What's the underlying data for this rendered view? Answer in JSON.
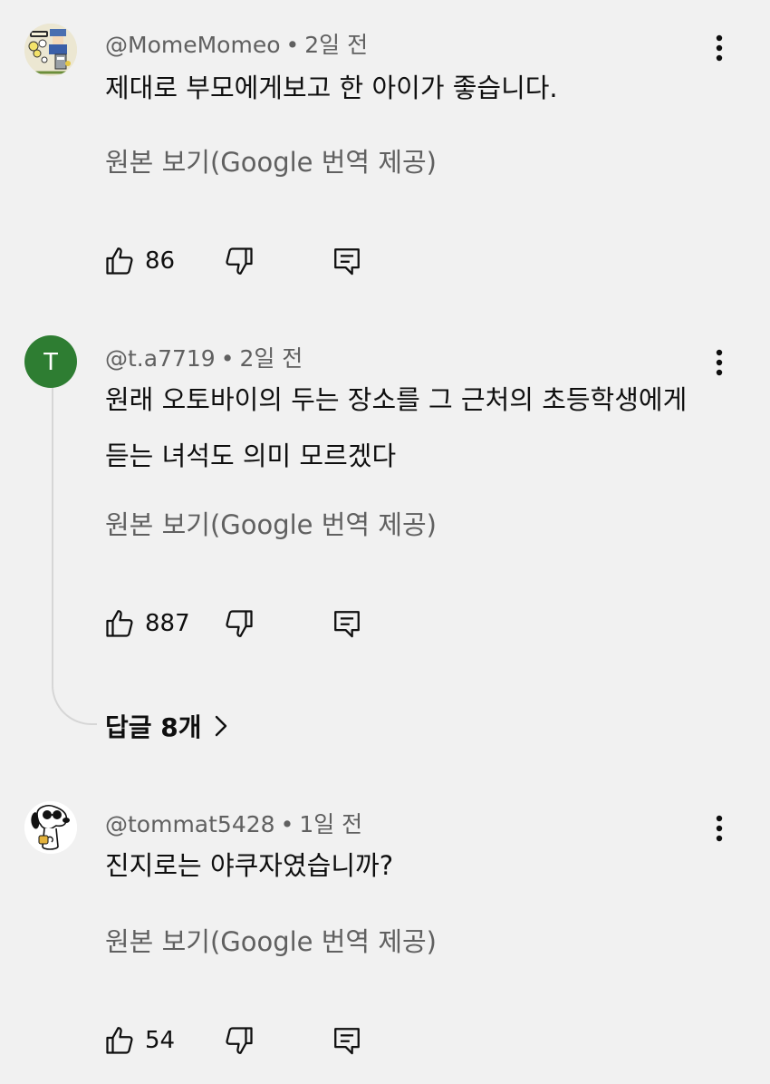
{
  "comments": [
    {
      "author": "@MomeMomeo",
      "age": "2일 전",
      "text_lines": [
        "제대로 부모에게보고 한 아이가 좋습니다."
      ],
      "translate_label": "원본 보기(Google 번역 제공)",
      "likes": "86",
      "avatar_icon": "cartoon-avatar"
    },
    {
      "author": "@t.a7719",
      "age": "2일 전",
      "text_lines": [
        "원래 오토바이의 두는 장소를 그 근처의 초등학생에게",
        "듣는 녀석도 의미 모르겠다"
      ],
      "translate_label": "원본 보기(Google 번역 제공)",
      "likes": "887",
      "avatar_letter": "T",
      "avatar_color": "#2e7d32"
    },
    {
      "author": "@tommat5428",
      "age": "1일 전",
      "text_lines": [
        "진지로는 야쿠자였습니까?"
      ],
      "translate_label": "원본 보기(Google 번역 제공)",
      "likes": "54",
      "avatar_icon": "snoopy-avatar"
    }
  ],
  "replies_label": "답글 8개",
  "icons": {
    "like": "thumbs-up-icon",
    "dislike": "thumbs-down-icon",
    "reply": "comment-icon",
    "more": "more-vert-icon",
    "chevron": "chevron-right-icon"
  }
}
